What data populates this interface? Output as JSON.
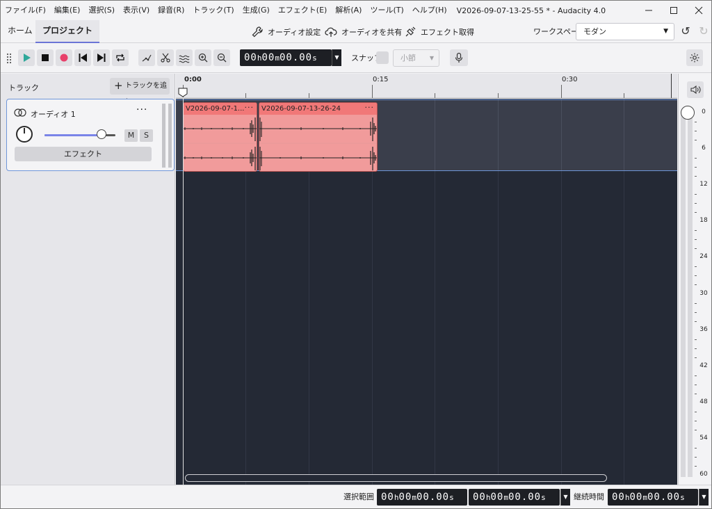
{
  "menubar": {
    "items": [
      "ファイル(F)",
      "編集(E)",
      "選択(S)",
      "表示(V)",
      "録音(R)",
      "トラック(T)",
      "生成(G)",
      "エフェクト(E)",
      "解析(A)",
      "ツール(T)",
      "ヘルプ(H)"
    ],
    "window_title": "V2026-09-07-13-25-55 * - Audacity 4.0"
  },
  "tabs": {
    "home": "ホーム",
    "project": "プロジェクト"
  },
  "top_actions": {
    "audio_settings": "オーディオ設定",
    "share_audio": "オーディオを共有",
    "get_effects": "エフェクト取得"
  },
  "workspace": {
    "label": "ワークスペース",
    "value": "モダン"
  },
  "toolbar": {
    "time_display": {
      "h": "00",
      "m": "00",
      "s": "00.00"
    },
    "snap_label": "スナップ",
    "snap_value": "小節"
  },
  "tracks_panel": {
    "title": "トラック",
    "add_track": "トラックを追加"
  },
  "track": {
    "name": "オーディオ 1",
    "mute": "M",
    "solo": "S",
    "effects": "エフェクト",
    "gain_fraction": 0.8
  },
  "ruler": {
    "labels": [
      "0:00",
      "0:15",
      "0:30"
    ]
  },
  "clips": [
    {
      "name": "V2026-09-07-1..."
    },
    {
      "name": "V2026-09-07-13-26-24"
    }
  ],
  "meter": {
    "labels": [
      "0",
      "6",
      "12",
      "18",
      "24",
      "30",
      "36",
      "42",
      "48",
      "54",
      "60"
    ]
  },
  "bottom": {
    "selection_label": "選択範囲",
    "duration_label": "継続時間",
    "sel_start": {
      "h": "00",
      "m": "00",
      "s": "00.00"
    },
    "sel_end": {
      "h": "00",
      "m": "00",
      "s": "00.00"
    },
    "duration": {
      "h": "00",
      "m": "00",
      "s": "00.00"
    }
  },
  "colors": {
    "accent": "#6b74d6",
    "clip_body": "#f19b9b",
    "clip_header": "#f17878",
    "canvas": "#242935",
    "record": "#e8406a",
    "play": "#2fa89a"
  }
}
